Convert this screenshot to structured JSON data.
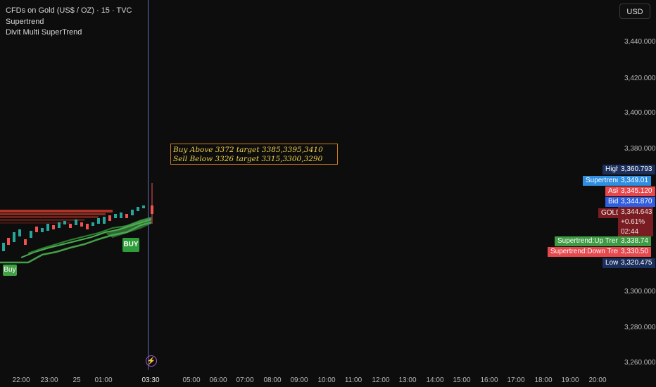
{
  "legend": {
    "symbol": "CFDs on Gold (US$ / OZ) · 15 · TVC",
    "indicator1": "Supertrend",
    "indicator2": "Divit Multi SuperTrend"
  },
  "currency": "USD",
  "price_axis": [
    "3,440.000",
    "3,420.000",
    "3,400.000",
    "3,380.000",
    "3,300.000",
    "3,280.000",
    "3,260.000"
  ],
  "time_axis": [
    "22:00",
    "23:00",
    "25",
    "01:00",
    "03:30",
    "05:00",
    "06:00",
    "07:00",
    "08:00",
    "09:00",
    "10:00",
    "11:00",
    "12:00",
    "13:00",
    "14:00",
    "15:00",
    "16:00",
    "17:00",
    "18:00",
    "19:00",
    "20:00"
  ],
  "note": {
    "line1": "Buy Above 3372 target 3385,3395,3410",
    "line2": "Sell Below 3326 target 3315,3300,3290"
  },
  "markers": {
    "buy_small": "Buy",
    "buy_big": "BUY"
  },
  "price_tags": {
    "high": {
      "label": "High",
      "value": "3,360.793"
    },
    "supertrend": {
      "label": "Supertrend",
      "value": "3,349.01"
    },
    "ask": {
      "label": "Ask",
      "value": "3,345.120"
    },
    "bid": {
      "label": "Bid",
      "value": "3,344.870"
    },
    "gold": {
      "label": "GOLD",
      "value": "3,344.643",
      "change": "+0.61%",
      "countdown": "02:44"
    },
    "up_trend": {
      "label": "Supertrend:Up Trend",
      "value": "3,338.74"
    },
    "down_trend": {
      "label": "Supertrend:Down Trend",
      "value": "3,330.50"
    },
    "low": {
      "label": "Low",
      "value": "3,320.475"
    }
  },
  "icons": {
    "alert": "lightning-icon"
  },
  "colors": {
    "background": "#0d0d0d",
    "up_candle": "#26a69a",
    "down_candle": "#ef5350",
    "supertrend_green": "#4caf50",
    "note_text": "#f2d04a",
    "note_border": "#c9781d"
  }
}
